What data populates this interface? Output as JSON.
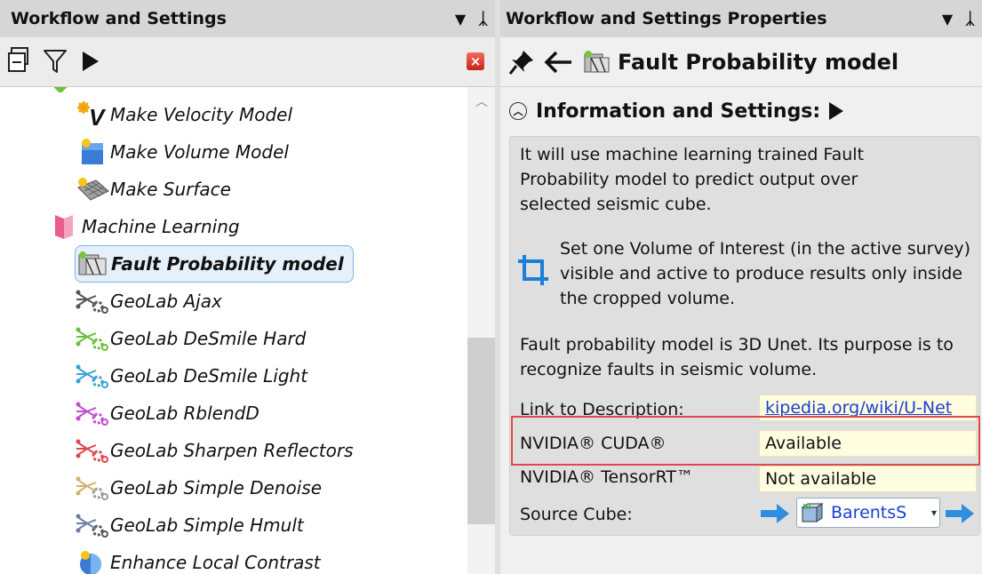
{
  "left_panel": {
    "title": "Workflow and Settings",
    "tree": [
      {
        "label": "Make Velocity Model",
        "icon": "velocity-model-icon"
      },
      {
        "label": "Make Volume Model",
        "icon": "volume-model-icon"
      },
      {
        "label": "Make Surface",
        "icon": "surface-icon"
      },
      {
        "label": "Machine Learning",
        "icon": "folder-icon"
      },
      {
        "label": "Fault Probability model",
        "icon": "fault-model-icon",
        "selected": true
      },
      {
        "label": "GeoLab Ajax",
        "icon": "geolab-icon"
      },
      {
        "label": "GeoLab DeSmile Hard",
        "icon": "geolab-icon"
      },
      {
        "label": "GeoLab DeSmile Light",
        "icon": "geolab-icon"
      },
      {
        "label": "GeoLab RblendD",
        "icon": "geolab-icon"
      },
      {
        "label": "GeoLab Sharpen Reflectors",
        "icon": "geolab-icon"
      },
      {
        "label": "GeoLab Simple Denoise",
        "icon": "geolab-icon"
      },
      {
        "label": "GeoLab Simple Hmult",
        "icon": "geolab-icon"
      },
      {
        "label": "Enhance Local Contrast",
        "icon": "contrast-icon"
      }
    ]
  },
  "right_panel": {
    "title": "Workflow and Settings Properties",
    "header_title": "Fault Probability model",
    "section_title": "Information and Settings:",
    "description": "It will use machine learning trained Fault Probability model to predict output over selected seismic cube.",
    "voi_note": "Set one Volume of Interest (in the active survey) visible and active to produce results only inside the cropped volume.",
    "model_note": "Fault probability model is 3D Unet. Its purpose is to recognize faults in seismic volume.",
    "rows": {
      "link_label": "Link to Description:",
      "link_value": "kipedia.org/wiki/U-Net",
      "cuda_label": "NVIDIA® CUDA®",
      "cuda_value": "Available",
      "tensorrt_label": "NVIDIA® TensorRT™",
      "tensorrt_value": "Not available",
      "source_label": "Source Cube:",
      "source_value": "BarentsS"
    }
  },
  "colors": {
    "selection_border": "#7cb4ea",
    "highlight_box": "#e0474c",
    "value_bg": "#fffde0",
    "link": "#1a3fd1"
  }
}
